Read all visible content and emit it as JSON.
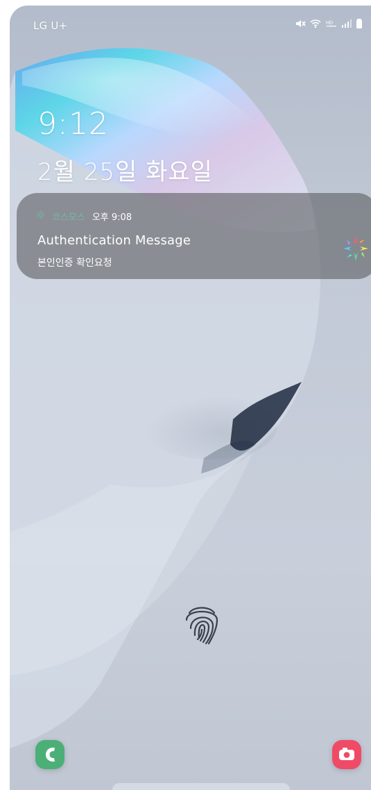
{
  "status_bar": {
    "carrier": "LG U+",
    "icons": [
      "mute-icon",
      "wifi-icon",
      "hd-icon",
      "signal-icon",
      "battery-icon"
    ]
  },
  "lock_screen": {
    "time": "9:12",
    "date": "2월 25일 화요일"
  },
  "notification": {
    "app_name": "코스모스",
    "time": "오후 9:08",
    "title": "Authentication Message",
    "body": "본인인증 확인요청",
    "accent_color": "#75b9a0"
  },
  "shortcuts": {
    "left_icon": "phone-icon",
    "right_icon": "camera-icon",
    "phone_color": "#4caf78",
    "camera_color": "#ef4b67"
  },
  "fingerprint": {
    "icon": "fingerprint-icon"
  }
}
